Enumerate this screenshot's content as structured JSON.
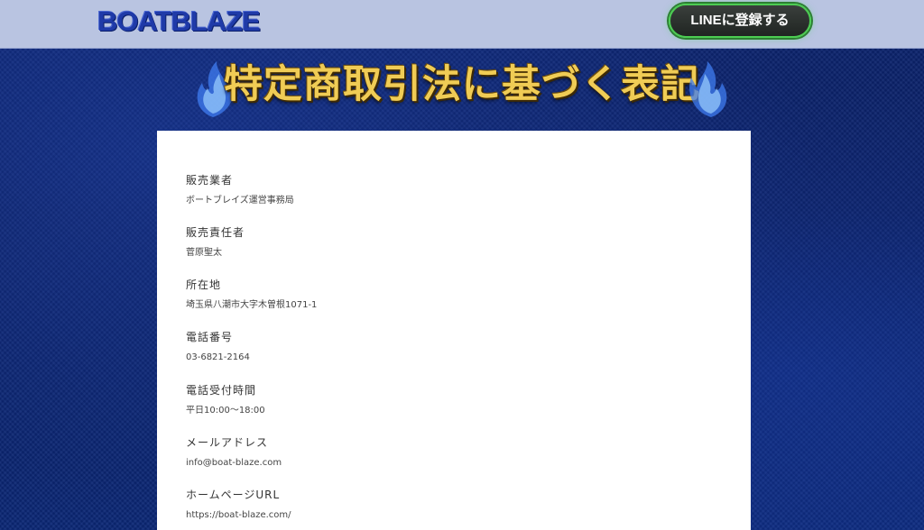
{
  "header": {
    "logo_text": "BOATBLAZE",
    "line_button_label": "LINEに登録する"
  },
  "banner": {
    "title": "特定商取引法に基づく表記"
  },
  "info": {
    "items": [
      {
        "label": "販売業者",
        "value": "ボートブレイズ運営事務局"
      },
      {
        "label": "販売責任者",
        "value": "菅原聖太"
      },
      {
        "label": "所在地",
        "value": "埼玉県八潮市大字木曽根1071-1"
      },
      {
        "label": "電話番号",
        "value": "03-6821-2164"
      },
      {
        "label": "電話受付時間",
        "value": "平日10:00〜18:00"
      },
      {
        "label": "メールアドレス",
        "value": "info@boat-blaze.com"
      },
      {
        "label": "ホームページURL",
        "value": "https://boat-blaze.com/"
      }
    ]
  },
  "colors": {
    "header_bg": "#b9c4e1",
    "logo_blue": "#1f3aa8",
    "line_green": "#4ccd52",
    "title_gold": "#f0cc55",
    "page_bg": "#0c2470"
  }
}
